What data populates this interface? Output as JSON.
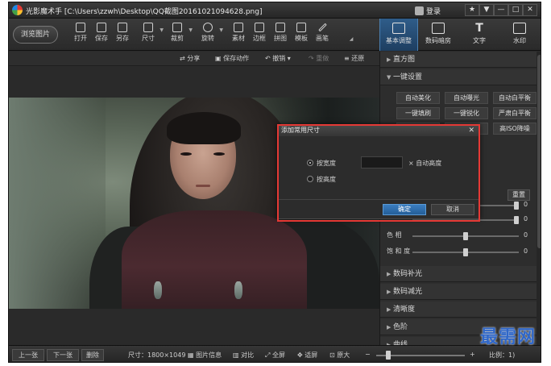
{
  "window": {
    "title": "光影魔术手 [C:\\Users\\zzwh\\Desktop\\QQ截图20161021094628.png]",
    "login_label": "登录",
    "controls": [
      "★",
      "▼",
      "—",
      "□",
      "✕"
    ]
  },
  "toolbar": {
    "browse_label": "浏览图片",
    "tools": [
      {
        "label": "打开",
        "icon": "open-icon",
        "has_arrow": false
      },
      {
        "label": "保存",
        "icon": "save-icon",
        "has_arrow": false
      },
      {
        "label": "另存",
        "icon": "save-as-icon",
        "has_arrow": false
      },
      {
        "label": "尺寸",
        "icon": "resize-icon",
        "has_arrow": true
      },
      {
        "label": "裁剪",
        "icon": "crop-icon",
        "has_arrow": true
      },
      {
        "label": "旋转",
        "icon": "rotate-icon",
        "has_arrow": true
      },
      {
        "label": "素材",
        "icon": "material-icon",
        "has_arrow": false
      },
      {
        "label": "边框",
        "icon": "border-icon",
        "has_arrow": false
      },
      {
        "label": "拼图",
        "icon": "collage-icon",
        "has_arrow": false
      },
      {
        "label": "模板",
        "icon": "template-icon",
        "has_arrow": false
      },
      {
        "label": "画笔",
        "icon": "brush-icon",
        "has_arrow": false
      }
    ],
    "right_tabs": [
      {
        "label": "基本调整",
        "icon": "adjust-icon",
        "active": true
      },
      {
        "label": "数码暗房",
        "icon": "darkroom-icon",
        "active": false
      },
      {
        "label": "文字",
        "icon": "text-icon",
        "active": false
      },
      {
        "label": "水印",
        "icon": "watermark-icon",
        "active": false
      }
    ]
  },
  "actionbar": {
    "share": "分享",
    "save_action": "保存动作",
    "undo": "撤销",
    "redo": "重做",
    "restore": "还原"
  },
  "panel": {
    "histogram": "直方图",
    "one_click": "一键设置",
    "presets": [
      "自动美化",
      "自动曝光",
      "自动白平衡",
      "一键填刷",
      "一键锐化",
      "严肃白平衡",
      "",
      "",
      "高ISO降噪"
    ],
    "reset_label": "重置",
    "sliders": [
      {
        "label": "",
        "value": "0",
        "level": 1.0
      },
      {
        "label": "",
        "value": "0",
        "level": 1.0
      },
      {
        "label": "色   相",
        "value": "0",
        "level": 0.5
      },
      {
        "label": "饱 和 度",
        "value": "0",
        "level": 0.5
      }
    ],
    "sections": [
      "数码补光",
      "数码减光",
      "清晰度",
      "色阶",
      "曲线"
    ]
  },
  "dialog": {
    "title": "添加常用尺寸",
    "close": "✕",
    "options": [
      {
        "label": "按宽度",
        "selected": true
      },
      {
        "label": "按高度",
        "selected": false
      }
    ],
    "input_value": "",
    "ratio_label": "× 自动高度",
    "ok": "确定",
    "cancel": "取消"
  },
  "bottombar": {
    "prev": "上一张",
    "next": "下一张",
    "delete": "删除",
    "size": "尺寸：1800×1049",
    "info": "图片信息",
    "compare": "对比",
    "fullscreen": "全屏",
    "fit": "适屏",
    "actual": "原大",
    "zoom_value": "比例：1)"
  },
  "watermark": "最需网",
  "colors": {
    "highlight": "#e53935",
    "accent": "#2f5d8a",
    "watermark": "#2f67c9"
  }
}
